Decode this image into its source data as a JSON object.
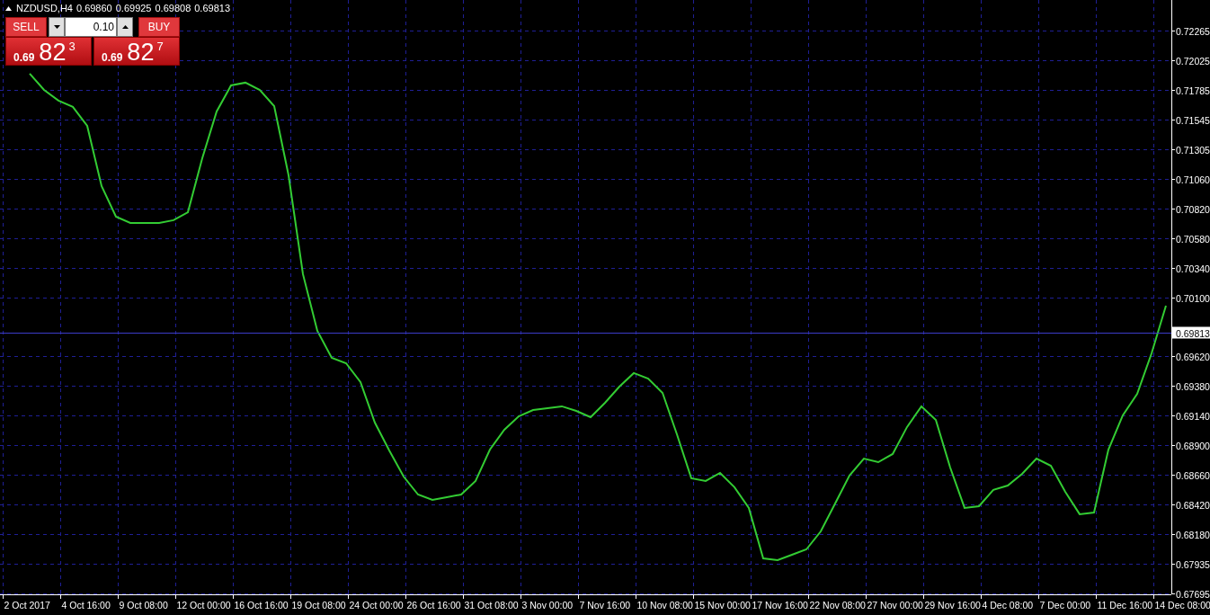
{
  "header": {
    "symbol": "NZDUSD,H4",
    "quotes": [
      "0.69860",
      "0.69925",
      "0.69808",
      "0.69813"
    ]
  },
  "trade_panel": {
    "sell_label": "SELL",
    "buy_label": "BUY",
    "lot": "0.10",
    "sell_price": {
      "prefix": "0.69",
      "main": "82",
      "last": "3"
    },
    "buy_price": {
      "prefix": "0.69",
      "main": "82",
      "last": "7"
    }
  },
  "chart": {
    "chart_data": {
      "type": "line",
      "categories": [
        "2 Oct 2017",
        null,
        null,
        null,
        "4 Oct 16:00",
        null,
        null,
        null,
        "9 Oct 08:00",
        null,
        null,
        null,
        "12 Oct 00:00",
        null,
        null,
        null,
        "16 Oct 16:00",
        null,
        null,
        null,
        "19 Oct 08:00",
        null,
        null,
        null,
        "24 Oct 00:00",
        null,
        null,
        null,
        "26 Oct 16:00",
        null,
        null,
        null,
        "31 Oct 08:00",
        null,
        null,
        null,
        "3 Nov 00:00",
        null,
        null,
        null,
        "7 Nov 16:00",
        null,
        null,
        null,
        "10 Nov 08:00",
        null,
        null,
        null,
        "15 Nov 00:00",
        null,
        null,
        null,
        "17 Nov 16:00",
        null,
        null,
        null,
        "22 Nov 08:00",
        null,
        null,
        null,
        "27 Nov 00:00",
        null,
        null,
        null,
        "29 Nov 16:00",
        null,
        null,
        null,
        "4 Dec 08:00",
        null,
        null,
        null,
        "7 Dec 00:00",
        null,
        null,
        null,
        "11 Dec 16:00",
        null,
        null,
        null,
        "14 Dec 08:00"
      ],
      "series": [
        {
          "color": "#33cc33",
          "values": [
            0.71915,
            0.71783,
            0.71696,
            0.71645,
            0.71491,
            0.71002,
            0.70754,
            0.70703,
            0.70703,
            0.70703,
            0.70725,
            0.7079,
            0.71228,
            0.71608,
            0.7182,
            0.71842,
            0.71783,
            0.71652,
            0.7109,
            0.70287,
            0.69827,
            0.69608,
            0.69564,
            0.69411,
            0.69082,
            0.68856,
            0.68644,
            0.68498,
            0.68454,
            0.68476,
            0.68498,
            0.68608,
            0.68863,
            0.69024,
            0.69133,
            0.69184,
            0.69199,
            0.69214,
            0.69177,
            0.69126,
            0.69243,
            0.69374,
            0.69484,
            0.6944,
            0.69323,
            0.68987,
            0.6863,
            0.68608,
            0.68673,
            0.68557,
            0.68389,
            0.6798,
            0.67965,
            0.68009,
            0.68053,
            0.68199,
            0.68425,
            0.68652,
            0.6879,
            0.68761,
            0.68827,
            0.69046,
            0.69214,
            0.69104,
            0.68717,
            0.68389,
            0.68403,
            0.68535,
            0.68571,
            0.68666,
            0.6879,
            0.68732,
            0.6852,
            0.68338,
            0.68352,
            0.68863,
            0.69141,
            0.69316,
            0.69644,
            0.70031,
            null
          ]
        }
      ],
      "ylim": [
        0.67695,
        0.72265
      ],
      "grid": true,
      "ref_lines": [
        {
          "axis": "y",
          "value": 0.69813,
          "label": "0.69813"
        }
      ],
      "yticks": [
        {
          "value": 0.72265,
          "label": "0.72265"
        },
        {
          "value": 0.72025,
          "label": "0.72025"
        },
        {
          "value": 0.71785,
          "label": "0.71785"
        },
        {
          "value": 0.71545,
          "label": "0.71545"
        },
        {
          "value": 0.71305,
          "label": "0.71305"
        },
        {
          "value": 0.7106,
          "label": "0.71060"
        },
        {
          "value": 0.7082,
          "label": "0.70820"
        },
        {
          "value": 0.7058,
          "label": "0.70580"
        },
        {
          "value": 0.7034,
          "label": "0.70340"
        },
        {
          "value": 0.701,
          "label": "0.70100"
        },
        {
          "value": 0.6962,
          "label": "0.69620"
        },
        {
          "value": 0.6938,
          "label": "0.69380"
        },
        {
          "value": 0.6914,
          "label": "0.69140"
        },
        {
          "value": 0.689,
          "label": "0.68900"
        },
        {
          "value": 0.6866,
          "label": "0.68660"
        },
        {
          "value": 0.6842,
          "label": "0.68420"
        },
        {
          "value": 0.6818,
          "label": "0.68180"
        },
        {
          "value": 0.67935,
          "label": "0.67935"
        },
        {
          "value": 0.67695,
          "label": "0.67695"
        }
      ]
    }
  }
}
